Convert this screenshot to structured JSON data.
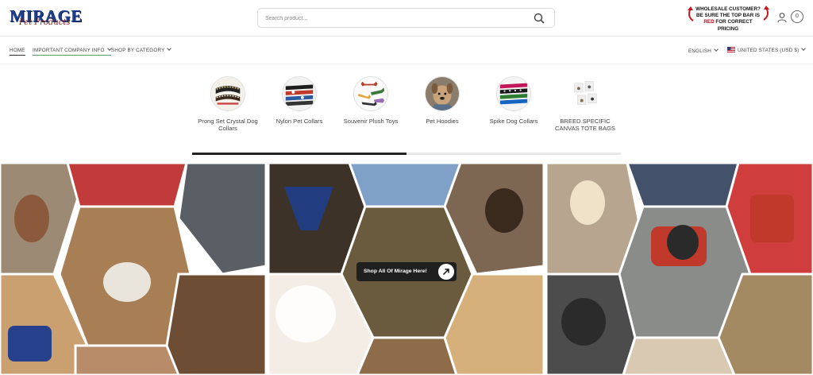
{
  "brand": {
    "name": "MIRAGE",
    "tagline": "Pet Products"
  },
  "search": {
    "placeholder": "Search product..."
  },
  "wholesale_notice": {
    "line1": "WHOLESALE CUSTOMER?",
    "line2": "BE SURE THE TOP BAR IS",
    "line3_red": "RED",
    "line3_rest": " FOR CORRECT PRICING"
  },
  "header": {
    "cart_count": "0"
  },
  "nav": {
    "home": "HOME",
    "company_info": "IMPORTANT COMPANY INFO",
    "shop_by_category": "SHOP BY CATEGORY",
    "language": "ENGLISH",
    "currency": "UNITED STATES (USD $)"
  },
  "categories": [
    {
      "label": "Prong Set Crystal Dog Collars"
    },
    {
      "label": "Nylon Pet Collars"
    },
    {
      "label": "Souvenir Plush Toys"
    },
    {
      "label": "Pet Hoodies"
    },
    {
      "label": "Spike Dog Collars"
    },
    {
      "label": "BREED SPECIFIC CANVAS TOTE BAGS"
    }
  ],
  "banner": {
    "cta": "Shop All Of Mirage Here!"
  },
  "colors": {
    "brand_blue": "#1e3f8f",
    "accent_red": "#d0021b",
    "nav_underline_green": "#5aa06a"
  }
}
